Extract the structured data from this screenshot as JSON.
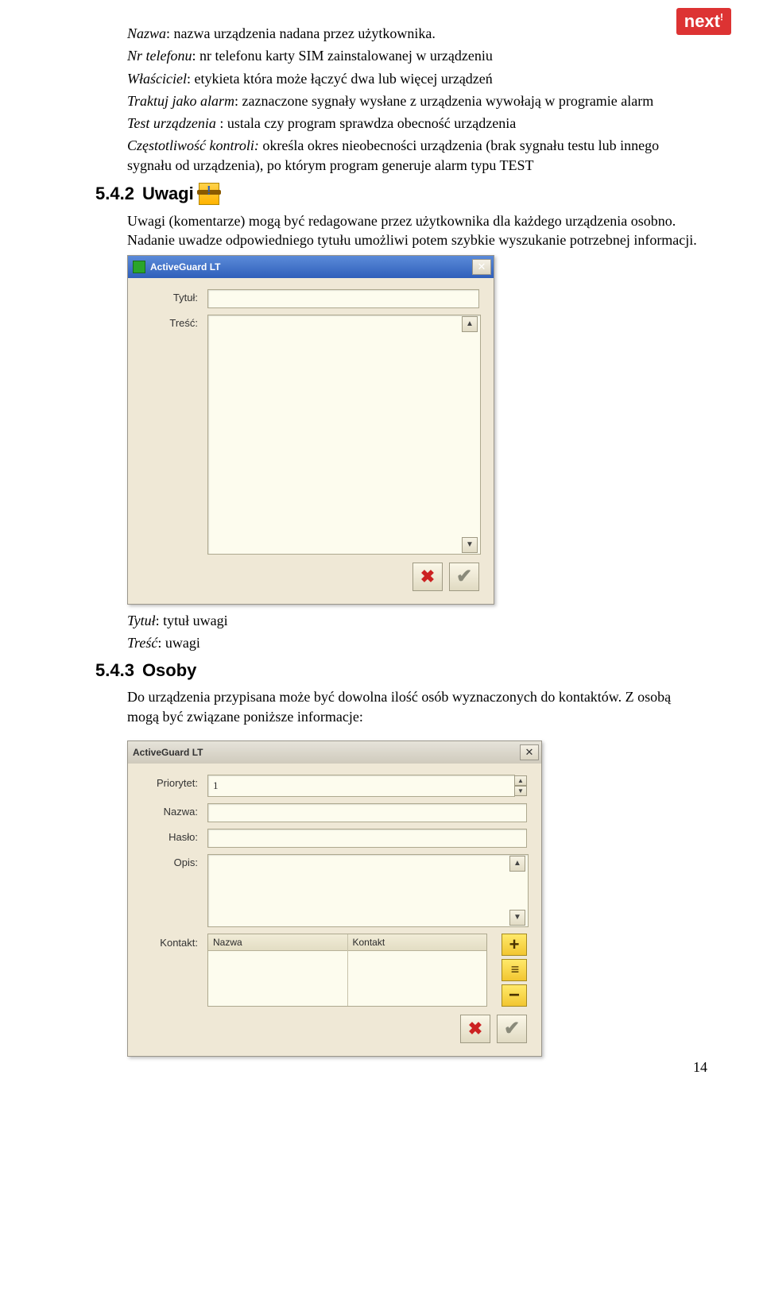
{
  "logo": "next",
  "intro": {
    "l1a": "Nazwa",
    "l1b": ": nazwa urządzenia nadana przez użytkownika.",
    "l2a": "Nr telefonu",
    "l2b": ": nr telefonu karty SIM zainstalowanej w urządzeniu",
    "l3a": "Właściciel",
    "l3b": ": etykieta która może łączyć dwa lub więcej urządzeń",
    "l4a": "Traktuj jako alarm",
    "l4b": ": zaznaczone sygnały wysłane z urządzenia wywołają w programie alarm",
    "l5a": "Test urządzenia",
    "l5b": " : ustala czy program sprawdza obecność urządzenia",
    "l6a": "Częstotliwość kontroli:",
    "l6b": " określa okres nieobecności urządzenia (brak sygnału testu lub innego sygnału od urządzenia), po którym program generuje alarm typu TEST"
  },
  "h1_num": "5.4.2",
  "h1_txt": "Uwagi",
  "p2a": "Uwagi (komentarze) mogą być redagowane przez użytkownika dla każdego urządzenia osobno. Nadanie uwadze odpowiedniego tytułu umożliwi potem szybkie wyszukanie potrzebnej informacji.",
  "win1": {
    "title": "ActiveGuard LT",
    "lbl_tytul": "Tytuł:",
    "lbl_tresc": "Treść:"
  },
  "after1": {
    "l1a": "Tytuł",
    "l1b": ": tytuł uwagi",
    "l2a": "Treść",
    "l2b": ": uwagi"
  },
  "h2_num": "5.4.3",
  "h2_txt": "Osoby",
  "p3a": "Do urządzenia przypisana może być dowolna ilość osób wyznaczonych do kontaktów. Z osobą mogą być związane poniższe informacje:",
  "win2": {
    "title": "ActiveGuard LT",
    "lbl_prio": "Priorytet:",
    "val_prio": "1",
    "lbl_nazwa": "Nazwa:",
    "lbl_haslo": "Hasło:",
    "lbl_opis": "Opis:",
    "lbl_kontakt": "Kontakt:",
    "col_nazwa": "Nazwa",
    "col_kontakt": "Kontakt"
  },
  "pagenum": "14"
}
